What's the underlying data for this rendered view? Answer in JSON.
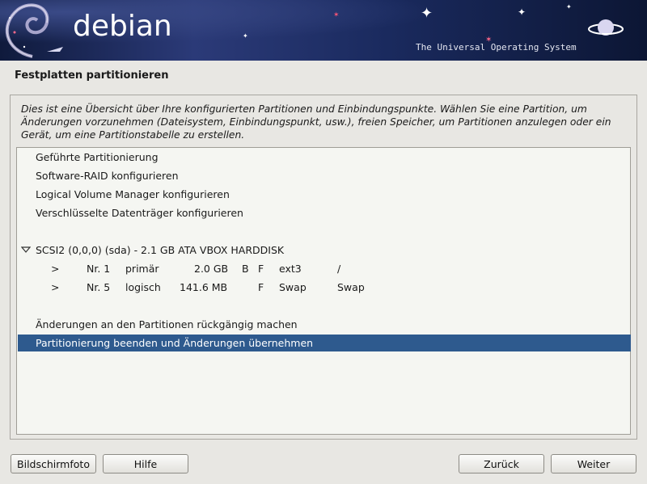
{
  "banner": {
    "brand": "debian",
    "tagline": "The Universal Operating System"
  },
  "page": {
    "title": "Festplatten partitionieren",
    "intro": "Dies ist eine Übersicht über Ihre konfigurierten Partitionen und Einbindungspunkte. Wählen Sie eine Partition, um Änderungen vorzunehmen (Dateisystem, Einbindungspunkt, usw.), freien Speicher, um Partitionen anzulegen oder ein Gerät, um eine Partitionstabelle zu erstellen."
  },
  "menu": {
    "guided": "Geführte Partitionierung",
    "raid": "Software-RAID konfigurieren",
    "lvm": "Logical Volume Manager konfigurieren",
    "crypto": "Verschlüsselte Datenträger konfigurieren",
    "undo": "Änderungen an den Partitionen rückgängig machen",
    "finish": "Partitionierung beenden und Änderungen übernehmen"
  },
  "disk": {
    "label": "SCSI2 (0,0,0) (sda) - 2.1 GB ATA VBOX HARDDISK",
    "expanded_icon": "triangle-down-icon",
    "partitions": [
      {
        "arrow": ">",
        "nr": "Nr. 1",
        "type": "primär",
        "size": "2.0 GB",
        "boot": "B",
        "format": "F",
        "fs": "ext3",
        "mount": "/"
      },
      {
        "arrow": ">",
        "nr": "Nr. 5",
        "type": "logisch",
        "size": "141.6 MB",
        "boot": "",
        "format": "F",
        "fs": "Swap",
        "mount": "Swap"
      }
    ]
  },
  "buttons": {
    "screenshot": "Bildschirmfoto",
    "help": "Hilfe",
    "back": "Zurück",
    "next": "Weiter"
  },
  "colors": {
    "selection": "#2e5a8e",
    "background": "#e8e7e3",
    "list_background": "#f5f6f2"
  }
}
